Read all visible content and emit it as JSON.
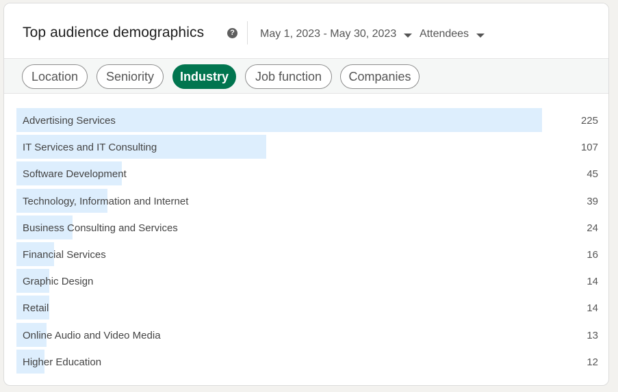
{
  "header": {
    "title": "Top audience demographics",
    "help_icon": "question-circle-icon",
    "date_range": "May 1, 2023 - May 30, 2023",
    "audience": "Attendees"
  },
  "tabs": [
    {
      "label": "Location",
      "active": false
    },
    {
      "label": "Seniority",
      "active": false
    },
    {
      "label": "Industry",
      "active": true
    },
    {
      "label": "Job function",
      "active": false
    },
    {
      "label": "Companies",
      "active": false
    }
  ],
  "colors": {
    "accent": "#01754f",
    "bar": "#ddeefd"
  },
  "industries": [
    {
      "label": "Advertising Services",
      "value": 225
    },
    {
      "label": "IT Services and IT Consulting",
      "value": 107
    },
    {
      "label": "Software Development",
      "value": 45
    },
    {
      "label": "Technology, Information and Internet",
      "value": 39
    },
    {
      "label": "Business Consulting and Services",
      "value": 24
    },
    {
      "label": "Financial Services",
      "value": 16
    },
    {
      "label": "Graphic Design",
      "value": 14
    },
    {
      "label": "Retail",
      "value": 14
    },
    {
      "label": "Online Audio and Video Media",
      "value": 13
    },
    {
      "label": "Higher Education",
      "value": 12
    }
  ]
}
